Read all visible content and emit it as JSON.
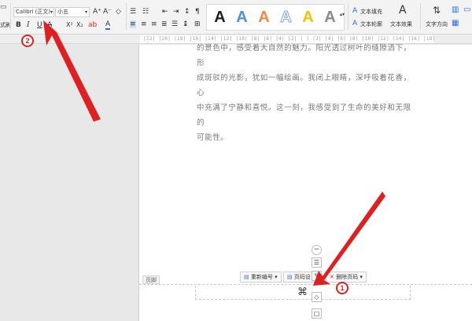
{
  "toolbar": {
    "left_partial_label": "式刷",
    "font_name": "Calibri (正文)",
    "font_size": "小五",
    "font_grow": "A⁺",
    "font_shrink": "A⁻",
    "bold": "B",
    "italic": "I",
    "underline": "U",
    "strike": "A",
    "superscript": "X²",
    "subscript": "X₂",
    "font_color_a": "A",
    "style_gallery": [
      {
        "glyph": "A",
        "color": "#1f1f1f"
      },
      {
        "glyph": "A",
        "color": "#4f8be8"
      },
      {
        "glyph": "A",
        "color": "#f08a40"
      },
      {
        "glyph": "A",
        "color": "#a9c4ec"
      },
      {
        "glyph": "A",
        "color": "#f2c200"
      },
      {
        "glyph": "A",
        "color": "#8a8a8a"
      }
    ],
    "text_fill": "文本填充",
    "text_outline": "文本轮廓",
    "text_effect": "文本效果",
    "text_direction": "文字方向"
  },
  "ruler": {
    "ticks": "|22| |20| |18| |16| |14| |12| |10| |8| |6| |4| |2| |  | |2| |4| |6| |8| |10| |12| |14| |16| |18|"
  },
  "document": {
    "lines": [
      "的景色中，感受着大自然的魅力。阳光透过树叶的缝隙洒下，形",
      "成斑驳的光影，犹如一幅绘画。我闭上眼睛，深呼吸着花香，心",
      "中充满了宁静和喜悦。这一刻，我感受到了生命的美好和无限的",
      "可能性。"
    ]
  },
  "footer": {
    "label": "页脚",
    "renumber": "重新编号",
    "page_setting": "页码设",
    "delete_page_number": "删除页码"
  },
  "annotations": {
    "badge_1": "1",
    "badge_2": "2",
    "arrow_color": "#e02020"
  }
}
